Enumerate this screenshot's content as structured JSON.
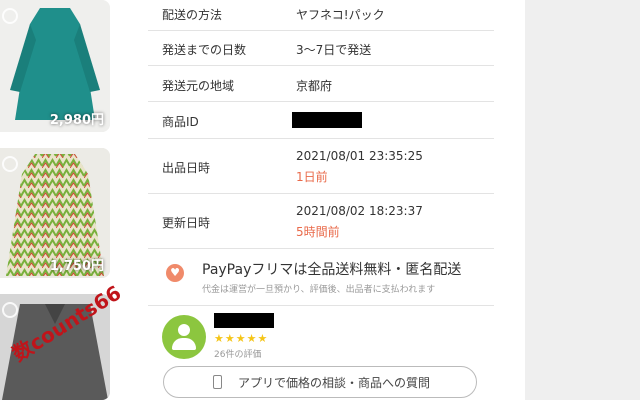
{
  "listing_thumbs": [
    {
      "price": "2,980円"
    },
    {
      "price": "1,750円"
    },
    {
      "price": ""
    }
  ],
  "watermark": "数counts66",
  "details": {
    "shipping_method": {
      "label": "配送の方法",
      "value": "ヤフネコ!パック"
    },
    "days_to_ship": {
      "label": "発送までの日数",
      "value": "3〜7日で発送"
    },
    "ship_from": {
      "label": "発送元の地域",
      "value": "京都府"
    },
    "item_id": {
      "label": "商品ID",
      "value": ""
    },
    "listed_at": {
      "label": "出品日時",
      "value": "2021/08/01 23:35:25",
      "relative": "1日前"
    },
    "updated_at": {
      "label": "更新日時",
      "value": "2021/08/02 18:23:37",
      "relative": "5時間前"
    }
  },
  "promo": {
    "title": "PayPayフリマは全品送料無料・匿名配送",
    "description": "代金は運営が一旦預かり、評価後、出品者に支払われます"
  },
  "seller": {
    "name": "",
    "stars": "★★★★★",
    "rating_count": "26件の評価"
  },
  "ask_button": {
    "label": "アプリで価格の相談・商品への質問"
  },
  "colors": {
    "accent": "#e96a4a",
    "avatar": "#8cc63f",
    "star": "#f5c518"
  }
}
